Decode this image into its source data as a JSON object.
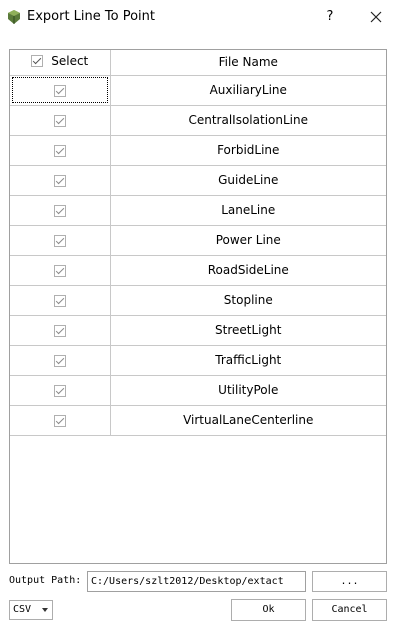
{
  "window": {
    "title": "Export Line To Point",
    "help_label": "?",
    "icon": "app-icon",
    "close_icon": "close-icon"
  },
  "table": {
    "columns": {
      "select": "Select",
      "file_name": "File Name"
    },
    "select_all_checked": true,
    "rows": [
      {
        "name": "AuxiliaryLine",
        "checked": true
      },
      {
        "name": "CentralIsolationLine",
        "checked": true
      },
      {
        "name": "ForbidLine",
        "checked": true
      },
      {
        "name": "GuideLine",
        "checked": true
      },
      {
        "name": "LaneLine",
        "checked": true
      },
      {
        "name": "Power Line",
        "checked": true
      },
      {
        "name": "RoadSideLine",
        "checked": true
      },
      {
        "name": "Stopline",
        "checked": true
      },
      {
        "name": "StreetLight",
        "checked": true
      },
      {
        "name": "TrafficLight",
        "checked": true
      },
      {
        "name": "UtilityPole",
        "checked": true
      },
      {
        "name": "VirtualLaneCenterline",
        "checked": true
      }
    ]
  },
  "output": {
    "label": "Output Path:",
    "path": "C:/Users/szlt2012/Desktop/extact",
    "browse_label": "..."
  },
  "format": {
    "selected": "CSV"
  },
  "buttons": {
    "ok": "Ok",
    "cancel": "Cancel"
  }
}
